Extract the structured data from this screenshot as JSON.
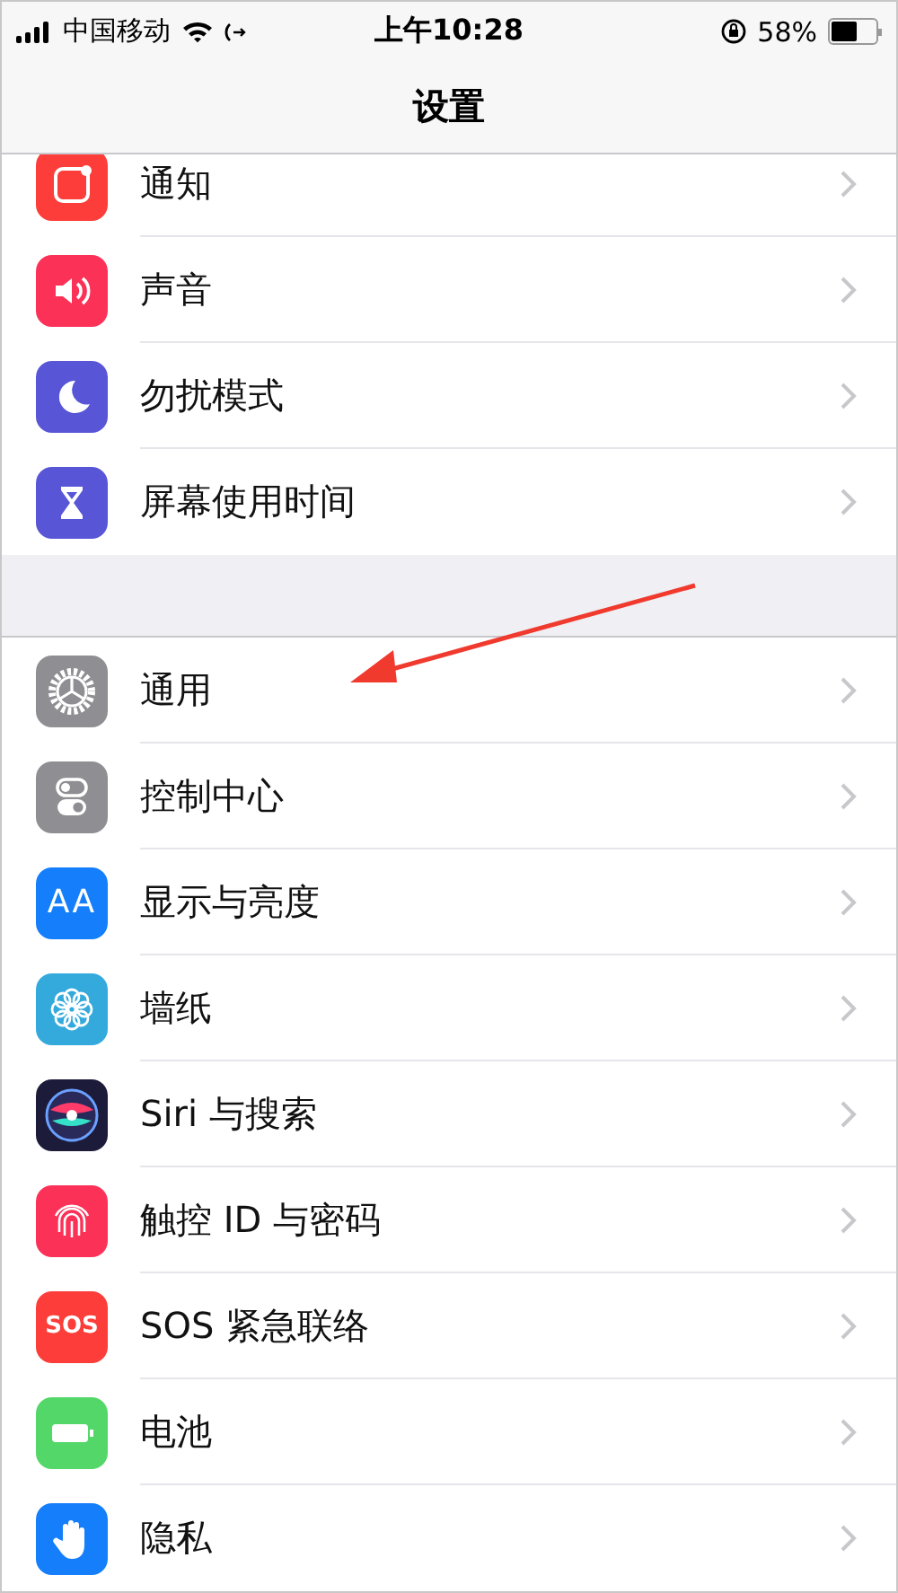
{
  "status_bar": {
    "carrier": "中国移动",
    "time": "上午10:28",
    "battery_percent": "58%"
  },
  "nav_bar": {
    "title": "设置"
  },
  "groups": [
    {
      "cut_top": true,
      "items": [
        {
          "label": "通知",
          "kind": "notifications",
          "color": "#fc3d39"
        },
        {
          "label": "声音",
          "kind": "sound",
          "color": "#fc3158"
        },
        {
          "label": "勿扰模式",
          "kind": "moon",
          "color": "#5856d6"
        },
        {
          "label": "屏幕使用时间",
          "kind": "hourglass",
          "color": "#5856d6"
        }
      ]
    },
    {
      "cut_top": false,
      "items": [
        {
          "label": "通用",
          "kind": "gear",
          "color": "#8e8e93"
        },
        {
          "label": "控制中心",
          "kind": "toggles",
          "color": "#8e8e93"
        },
        {
          "label": "显示与亮度",
          "kind": "text-size",
          "color": "#147efb",
          "badge": "AA"
        },
        {
          "label": "墙纸",
          "kind": "flower",
          "color": "#34aadc"
        },
        {
          "label": "Siri 与搜索",
          "kind": "siri",
          "color": "#1c1c3a"
        },
        {
          "label": "触控 ID 与密码",
          "kind": "fingerprint",
          "color": "#fc3158"
        },
        {
          "label": "SOS 紧急联络",
          "kind": "sos",
          "color": "#fc3d39",
          "badge": "SOS"
        },
        {
          "label": "电池",
          "kind": "battery",
          "color": "#53d769"
        },
        {
          "label": "隐私",
          "kind": "hand",
          "color": "#147efb"
        }
      ]
    }
  ]
}
